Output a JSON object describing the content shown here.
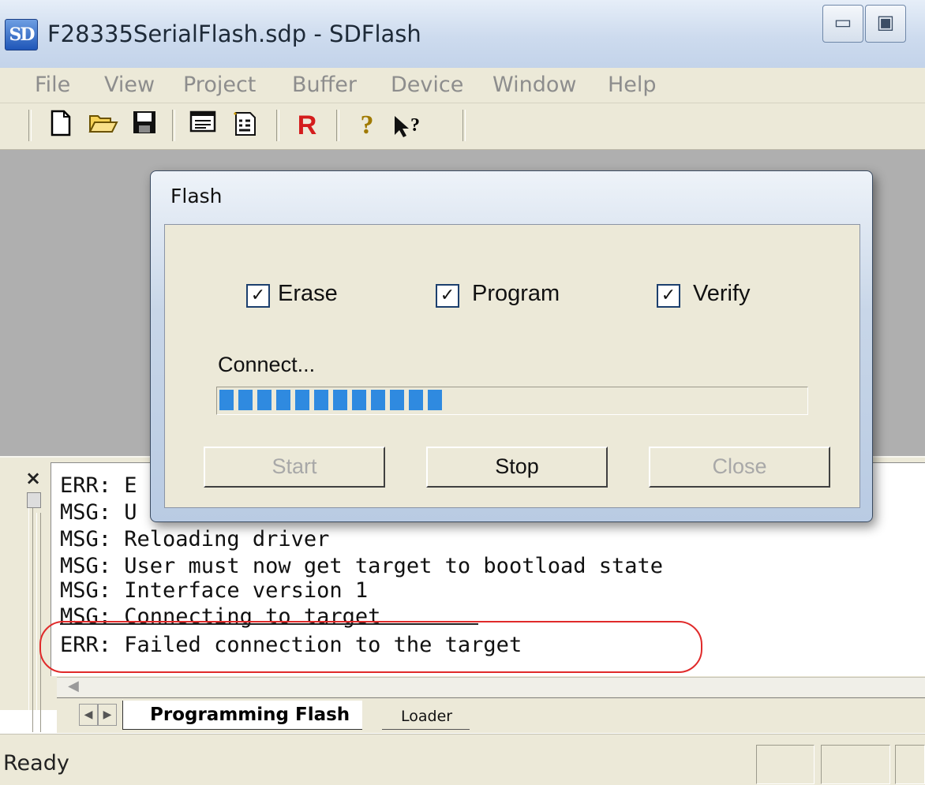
{
  "window": {
    "icon_text": "SD",
    "title": "F28335SerialFlash.sdp - SDFlash"
  },
  "menu": [
    "File",
    "View",
    "Project",
    "Buffer",
    "Device",
    "Window",
    "Help"
  ],
  "toolbar": {
    "icons": [
      "new-file-icon",
      "open-folder-icon",
      "save-icon",
      "list-view-icon",
      "binary-file-icon",
      "reset-icon",
      "help-icon",
      "context-help-icon"
    ],
    "reset_label": "R",
    "help_glyph": "?",
    "context_help_glyph": "?"
  },
  "output": {
    "close_glyph": "×",
    "lines": [
      "ERR: E",
      "MSG: U",
      "MSG: Reloading driver",
      "MSG: User must now get target to bootload state",
      "MSG: Interface version 1",
      "MSG: Connecting to target",
      "ERR: Failed connection to the target"
    ],
    "highlight_color": "#e02a2a",
    "tabs": [
      "Programming Flash",
      "Loader"
    ],
    "tab_left_arrow": "◀",
    "tab_right_arrow": "▶",
    "scroll_left_glyph": "◀"
  },
  "flash_dialog": {
    "title": "Flash",
    "checkboxes": [
      {
        "label": "Erase",
        "checked": true
      },
      {
        "label": "Program",
        "checked": true
      },
      {
        "label": "Verify",
        "checked": true
      }
    ],
    "check_glyph": "✓",
    "progress_label": "Connect...",
    "progress_fraction": 0.36,
    "progress_color": "#2f8ae0",
    "buttons": {
      "start": "Start",
      "stop": "Stop",
      "close": "Close"
    }
  },
  "status": {
    "text": "Ready"
  }
}
